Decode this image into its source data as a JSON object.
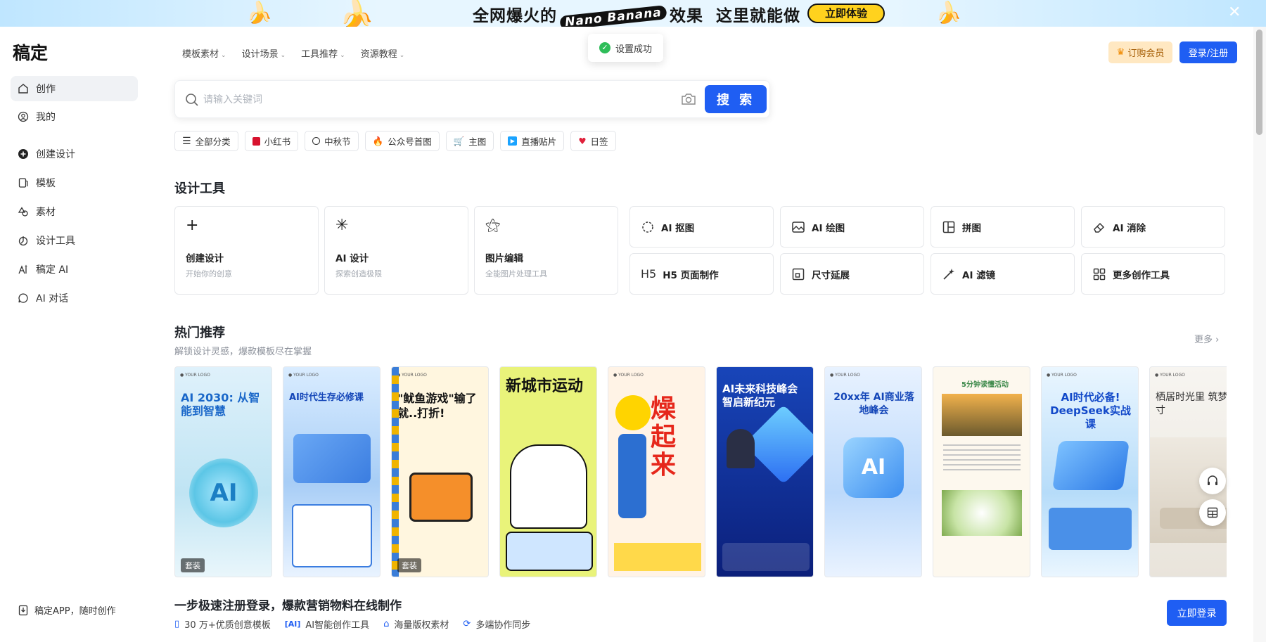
{
  "banner": {
    "headline_part1": "全网爆火的",
    "brand_badge": "Nano Banana",
    "headline_part2": "效果  这里就能做",
    "cta": "立即体验",
    "close": "✕"
  },
  "sidebar": {
    "logo": "稿定",
    "items": [
      {
        "label": "创作",
        "icon": "home-icon"
      },
      {
        "label": "我的",
        "icon": "user-icon"
      },
      {
        "label": "创建设计",
        "icon": "plus-circle-icon"
      },
      {
        "label": "模板",
        "icon": "template-icon"
      },
      {
        "label": "素材",
        "icon": "shapes-icon"
      },
      {
        "label": "设计工具",
        "icon": "tools-icon"
      },
      {
        "label": "稿定 AI",
        "icon": "ai-icon"
      },
      {
        "label": "AI 对话",
        "icon": "chat-icon"
      }
    ],
    "bottom": "稿定APP，随时创作"
  },
  "topnav": {
    "items": [
      "模板素材",
      "设计场景",
      "工具推荐",
      "资源教程"
    ]
  },
  "header": {
    "vip": "订购会员",
    "login": "登录/注册"
  },
  "toast": {
    "text": "设置成功"
  },
  "search": {
    "placeholder": "请输入关键词",
    "button": "搜 索"
  },
  "chips": [
    "全部分类",
    "小红书",
    "中秋节",
    "公众号首图",
    "主图",
    "直播贴片",
    "日签"
  ],
  "tools": {
    "title": "设计工具",
    "big": [
      {
        "title": "创建设计",
        "sub": "开始你的创意"
      },
      {
        "title": "AI 设计",
        "sub": "探索创造极限"
      },
      {
        "title": "图片编辑",
        "sub": "全能图片处理工具"
      }
    ],
    "small": [
      "AI 抠图",
      "AI 绘图",
      "拼图",
      "AI 消除",
      "H5 页面制作",
      "尺寸延展",
      "AI 滤镜",
      "更多创作工具"
    ]
  },
  "hot": {
    "title": "热门推荐",
    "sub": "解锁设计灵感，爆款模板尽在掌握",
    "more": "更多",
    "cards": [
      {
        "title": "AI 2030: 从智能到智慧",
        "tag": "套装"
      },
      {
        "title": "AI时代生存必修课",
        "tag": ""
      },
      {
        "title": "\"鱿鱼游戏\"输了就..打折!",
        "tag": "套装"
      },
      {
        "title": "新城市运动",
        "tag": ""
      },
      {
        "title": "燥起来",
        "tag": ""
      },
      {
        "title": "AI未来科技峰会 智启新纪元",
        "tag": ""
      },
      {
        "title": "20xx年 AI商业落地峰会",
        "tag": ""
      },
      {
        "title": "5分钟读懂活动",
        "tag": ""
      },
      {
        "title": "AI时代必备! DeepSeek实战课",
        "tag": ""
      },
      {
        "title": "栖居时光里 筑梦方寸",
        "tag": ""
      }
    ]
  },
  "promo": {
    "title": "一步极速注册登录，爆款营销物料在线制作",
    "features": [
      "30 万+优质创意模板",
      "AI智能创作工具",
      "海量版权素材",
      "多端协作同步"
    ],
    "button": "立即登录"
  }
}
